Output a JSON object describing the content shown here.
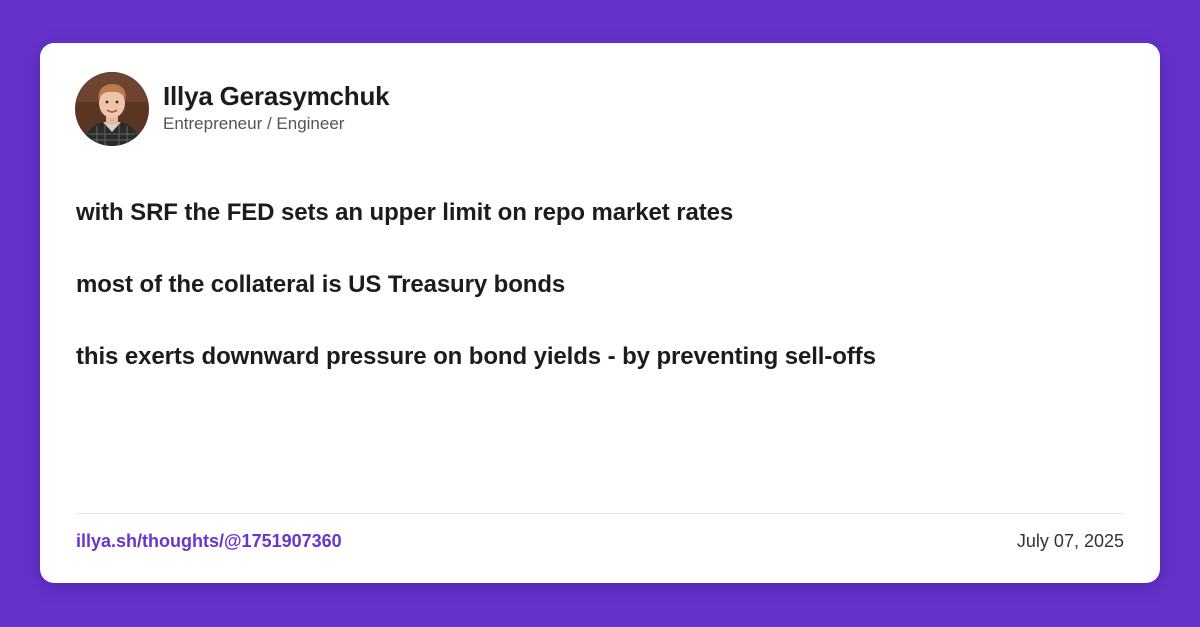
{
  "colors": {
    "background": "#6632cc",
    "card": "#ffffff",
    "text": "#1c1c1c",
    "subtitle": "#555555",
    "link": "#6a35cf"
  },
  "author": {
    "name": "Illya Gerasymchuk",
    "title": "Entrepreneur / Engineer",
    "avatar_icon": "profile-photo"
  },
  "post": {
    "lines": [
      "with SRF the FED sets an upper limit on repo market rates",
      "most of the collateral is US Treasury bonds",
      "this exerts downward pressure on bond yields - by preventing sell-offs"
    ]
  },
  "footer": {
    "link_text": "illya.sh/thoughts/@1751907360",
    "date": "July 07, 2025"
  }
}
